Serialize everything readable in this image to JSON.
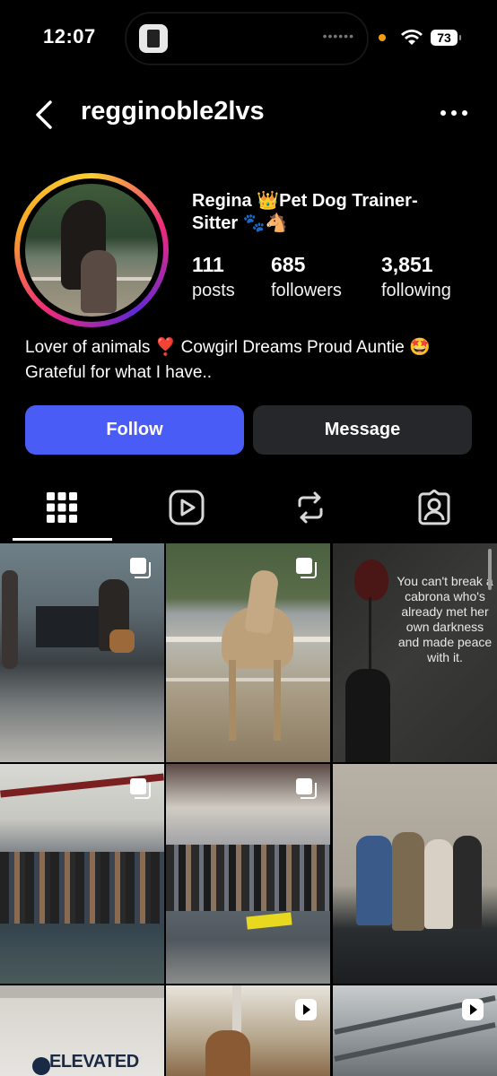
{
  "status_bar": {
    "time": "12:07",
    "battery": "73",
    "island_dots": "••••••"
  },
  "profile": {
    "username": "regginoble2lvs",
    "display_name": "Regina 👑Pet Dog Trainer-Sitter 🐾🐴",
    "bio": "Lover of animals ❣️ Cowgirl Dreams Proud Auntie 🤩 Grateful for what I have..",
    "stats": {
      "posts": {
        "count": "111",
        "label": "posts"
      },
      "followers": {
        "count": "685",
        "label": "followers"
      },
      "following": {
        "count": "3,851",
        "label": "following"
      }
    }
  },
  "actions": {
    "follow": "Follow",
    "message": "Message"
  },
  "tabs": [
    {
      "name": "posts-grid",
      "icon": "grid-icon",
      "selected": true
    },
    {
      "name": "reels",
      "icon": "reels-play-icon",
      "selected": false
    },
    {
      "name": "reposts",
      "icon": "repost-icon",
      "selected": false
    },
    {
      "name": "tagged",
      "icon": "tagged-person-icon",
      "selected": false
    }
  ],
  "grid": {
    "quote_text": "You can't break a cabrona who's already met her own darkness and made peace with it.",
    "brand_text": "ELEVATED"
  },
  "colors": {
    "follow_button": "#4a5cf6",
    "message_button": "#26272b",
    "background": "#000000",
    "status_dot": "#f59e0b"
  }
}
